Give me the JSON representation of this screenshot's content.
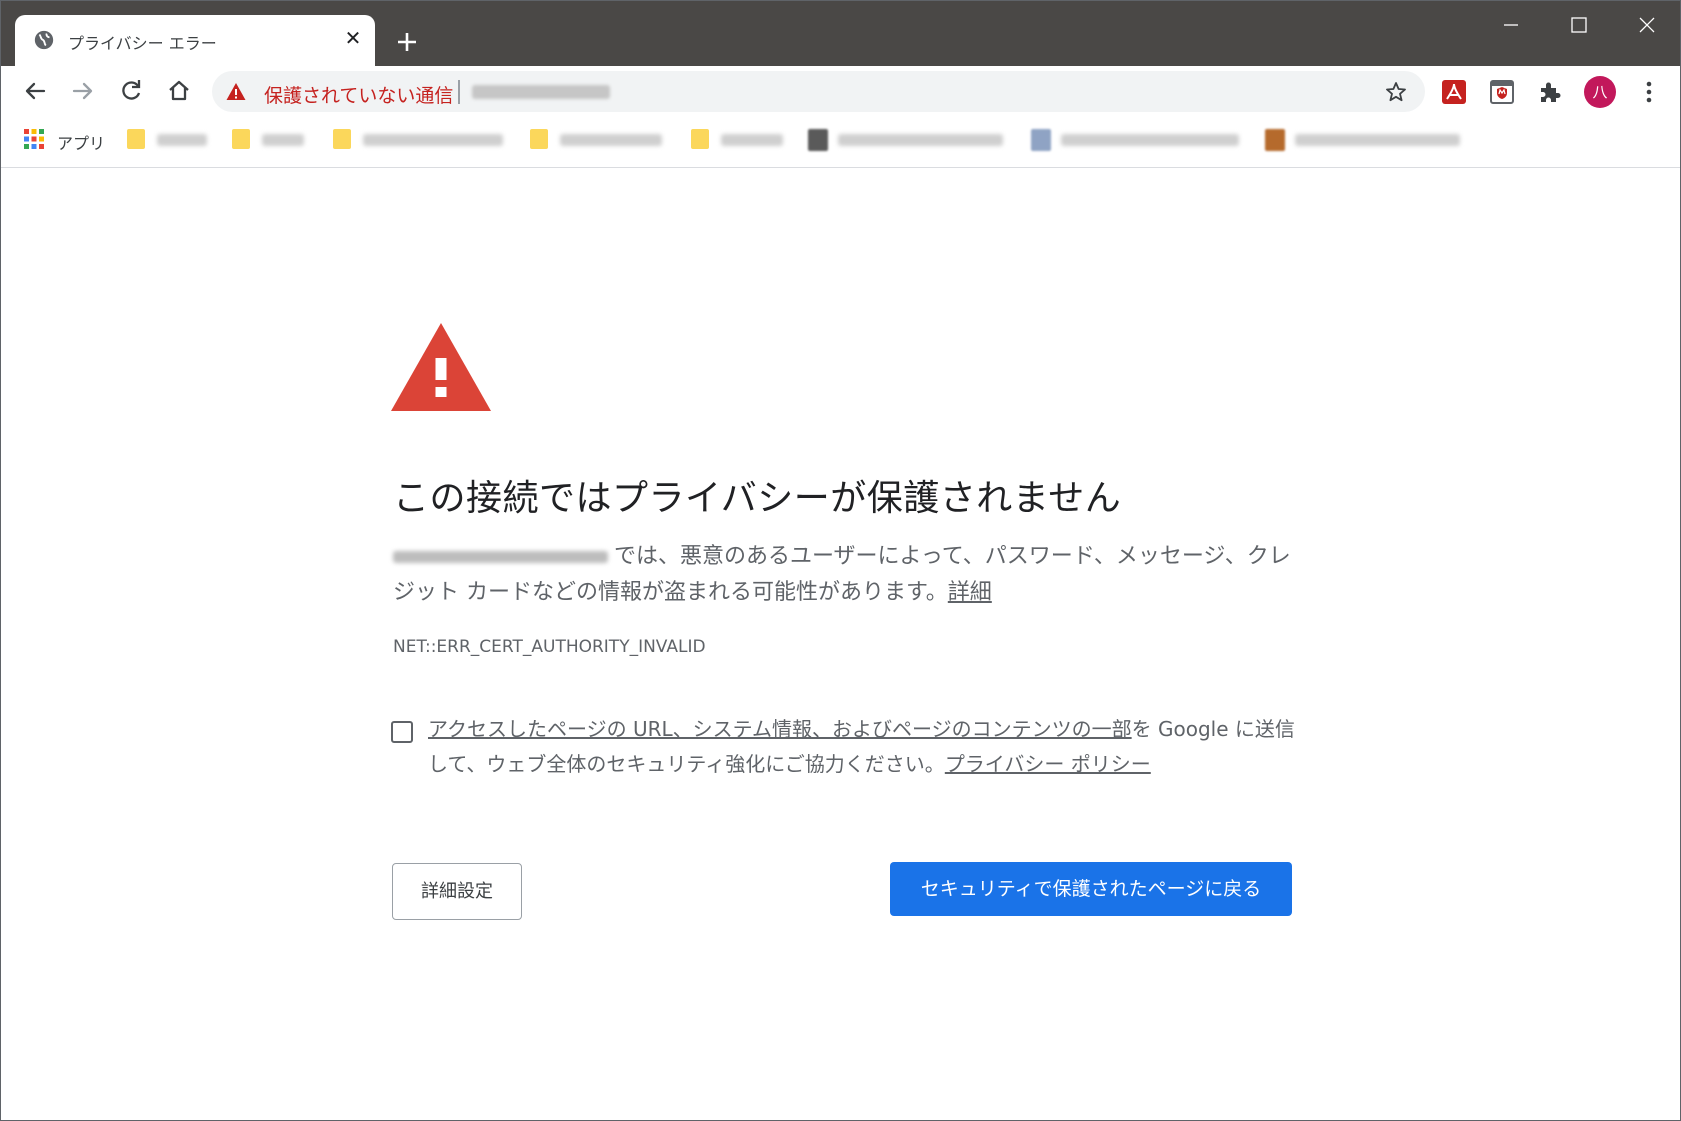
{
  "tab": {
    "title": "プライバシー エラー",
    "close_glyph": "✕"
  },
  "window_controls": [
    "minimize",
    "maximize",
    "close"
  ],
  "omnibox": {
    "security_text": "保護されていない通信"
  },
  "profile": {
    "avatar_letter": "八"
  },
  "bookmarks": {
    "apps_label": "アプリ"
  },
  "interstitial": {
    "heading": "この接続ではプライバシーが保護されません",
    "description": "では、悪意のあるユーザーによって、パスワード、メッセージ、クレジット カードなどの情報が盗まれる可能性があります。",
    "details_link": "詳細",
    "error_code": "NET::ERR_CERT_AUTHORITY_INVALID",
    "report_link": "アクセスしたページの URL、システム情報、およびページのコンテンツの一部",
    "report_text": "を Google に送信して、ウェブ全体のセキュリティ強化にご協力ください。",
    "privacy_link": "プライバシー ポリシー",
    "advanced_button": "詳細設定",
    "back_button": "セキュリティで保護されたページに戻る"
  },
  "colors": {
    "warning_red": "#db4437",
    "insecure_text": "#c5221f",
    "primary_blue": "#1a73e8",
    "frame": "#4a4846",
    "avatar_bg": "#c2185b"
  }
}
